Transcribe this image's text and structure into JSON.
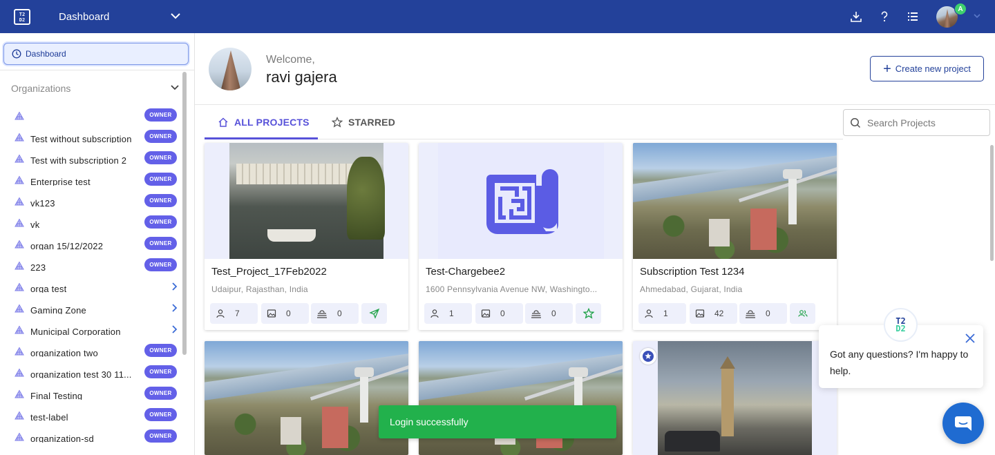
{
  "topbar": {
    "logo_text": "T2\nD2",
    "title": "Dashboard",
    "avatar_badge": "A",
    "icons": [
      "download-icon",
      "help-icon",
      "list-icon"
    ]
  },
  "sidebar": {
    "dashboard_label": "Dashboard",
    "organizations_label": "Organizations",
    "orgs": [
      {
        "name": "",
        "badge": "OWNER"
      },
      {
        "name": "Test without subscription",
        "badge": "OWNER"
      },
      {
        "name": "Test with subscription 2",
        "badge": "OWNER"
      },
      {
        "name": "Enterprise test",
        "badge": "OWNER"
      },
      {
        "name": "vk123",
        "badge": "OWNER"
      },
      {
        "name": "vk",
        "badge": "OWNER"
      },
      {
        "name": "organ 15/12/2022",
        "badge": "OWNER"
      },
      {
        "name": "223",
        "badge": "OWNER"
      },
      {
        "name": "orga test",
        "badge": ""
      },
      {
        "name": "Gaming Zone",
        "badge": ""
      },
      {
        "name": "Municipal Corporation",
        "badge": ""
      },
      {
        "name": "organization two",
        "badge": "OWNER"
      },
      {
        "name": "organization test   30 11...",
        "badge": "OWNER"
      },
      {
        "name": "Final Testing",
        "badge": "OWNER"
      },
      {
        "name": "test-label",
        "badge": "OWNER"
      },
      {
        "name": "organization-sd",
        "badge": "OWNER"
      }
    ]
  },
  "header": {
    "welcome": "Welcome,",
    "user_name": "ravi gajera",
    "create_button": "Create new project"
  },
  "tabs": {
    "all": "ALL PROJECTS",
    "starred": "STARRED"
  },
  "search": {
    "placeholder": "Search Projects",
    "value": ""
  },
  "projects": [
    {
      "title": "Test_Project_17Feb2022",
      "location": "Udaipur, Rajasthan, India",
      "members": "7",
      "images": "0",
      "layers": "0",
      "action_icon": "send-icon"
    },
    {
      "title": "Test-Chargebee2",
      "location": "1600 Pennsylvania Avenue NW, Washingto...",
      "members": "1",
      "images": "0",
      "layers": "0",
      "action_icon": "star-outline-icon"
    },
    {
      "title": "Subscription Test 1234",
      "location": "Ahmedabad, Gujarat, India",
      "members": "1",
      "images": "42",
      "layers": "0",
      "action_icon": "group-icon"
    }
  ],
  "toast": {
    "message": "Login successfully"
  },
  "chat": {
    "message": "Got any questions? I'm happy to help.",
    "logo_top": "T2",
    "logo_bottom": "D2"
  },
  "colors": {
    "topbar": "#23419a",
    "accent": "#5751d9",
    "owner_badge": "#6360e8",
    "toast": "#22b14c",
    "chat_fab": "#1f6bd1"
  }
}
